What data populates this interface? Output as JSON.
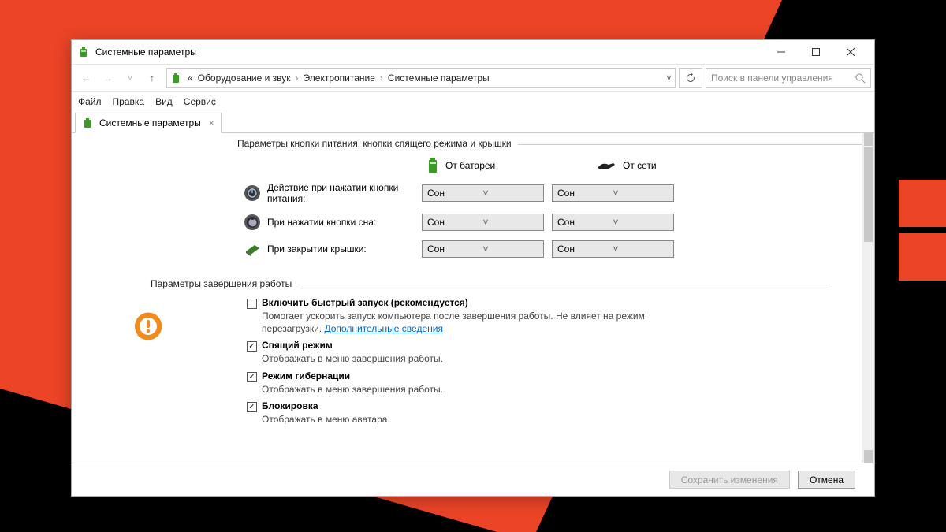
{
  "title": "Системные параметры",
  "breadcrumb": {
    "prefix": "«",
    "c1": "Оборудование и звук",
    "c2": "Электропитание",
    "c3": "Системные параметры"
  },
  "menu": {
    "file": "Файл",
    "edit": "Правка",
    "view": "Вид",
    "service": "Сервис"
  },
  "tab": {
    "label": "Системные параметры"
  },
  "search": {
    "placeholder": "Поиск в панели управления"
  },
  "section1": {
    "title": "Параметры кнопки питания, кнопки спящего режима и крышки"
  },
  "cols": {
    "battery": "От батареи",
    "ac": "От сети"
  },
  "rows": {
    "power": {
      "label": "Действие при нажатии кнопки питания:",
      "bat": "Сон",
      "ac": "Сон"
    },
    "sleep": {
      "label": "При нажатии кнопки сна:",
      "bat": "Сон",
      "ac": "Сон"
    },
    "lid": {
      "label": "При закрытии крышки:",
      "bat": "Сон",
      "ac": "Сон"
    }
  },
  "section2": {
    "title": "Параметры завершения работы"
  },
  "cb1": {
    "label": "Включить быстрый запуск (рекомендуется)",
    "desc": "Помогает ускорить запуск компьютера после завершения работы. Не влияет на режим перезагрузки.",
    "link": "Дополнительные сведения"
  },
  "cb2": {
    "label": "Спящий режим",
    "desc": "Отображать в меню завершения работы."
  },
  "cb3": {
    "label": "Режим гибернации",
    "desc": "Отображать в меню завершения работы."
  },
  "cb4": {
    "label": "Блокировка",
    "desc": "Отображать в меню аватара."
  },
  "footer": {
    "save": "Сохранить изменения",
    "cancel": "Отмена"
  }
}
